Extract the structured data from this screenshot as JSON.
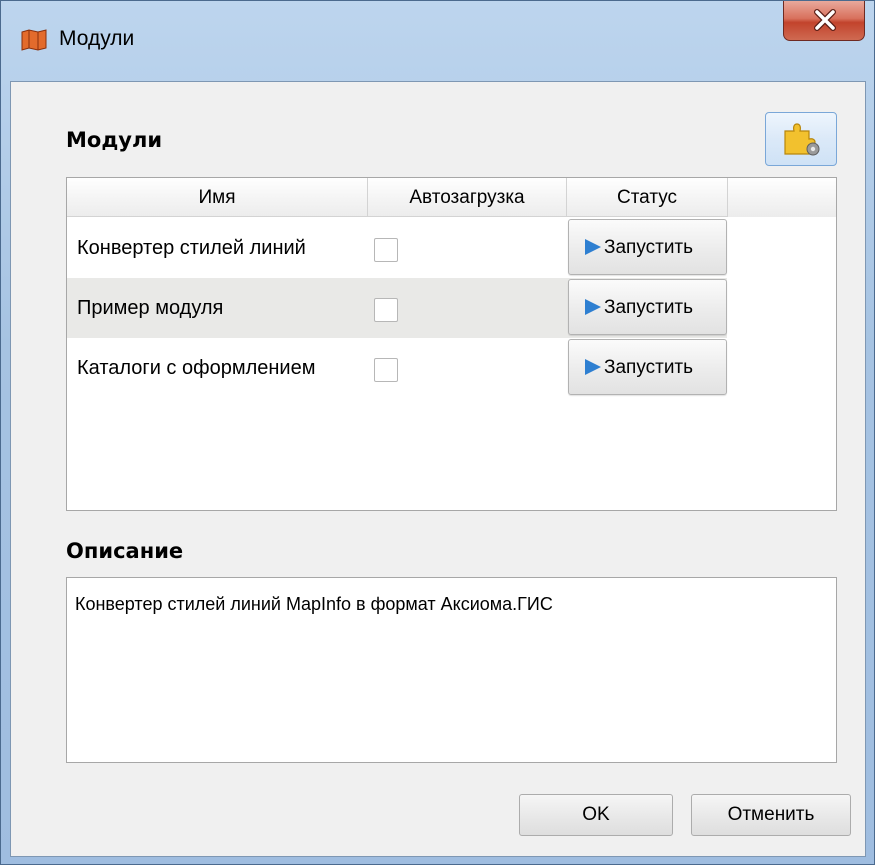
{
  "window": {
    "title": "Модули",
    "close_icon": "close-x-icon",
    "app_icon": "map-icon"
  },
  "plugins_section": {
    "title": "Модули",
    "settings_icon": "puzzle-gear-icon"
  },
  "table": {
    "columns": [
      "Имя",
      "Автозагрузка",
      "Статус"
    ],
    "rows": [
      {
        "name": "Конвертер стилей линий",
        "autoload": false,
        "action": "Запустить"
      },
      {
        "name": "Пример модуля",
        "autoload": false,
        "action": "Запустить"
      },
      {
        "name": "Каталоги с оформлением",
        "autoload": false,
        "action": "Запустить"
      }
    ]
  },
  "description": {
    "title": "Описание",
    "text": "Конвертер стилей линий MapInfo в формат Аксиома.ГИС"
  },
  "buttons": {
    "ok": "OK",
    "cancel": "Отменить"
  },
  "colors": {
    "play_icon": "#2e7fd1",
    "close_button": "#c7432c"
  }
}
